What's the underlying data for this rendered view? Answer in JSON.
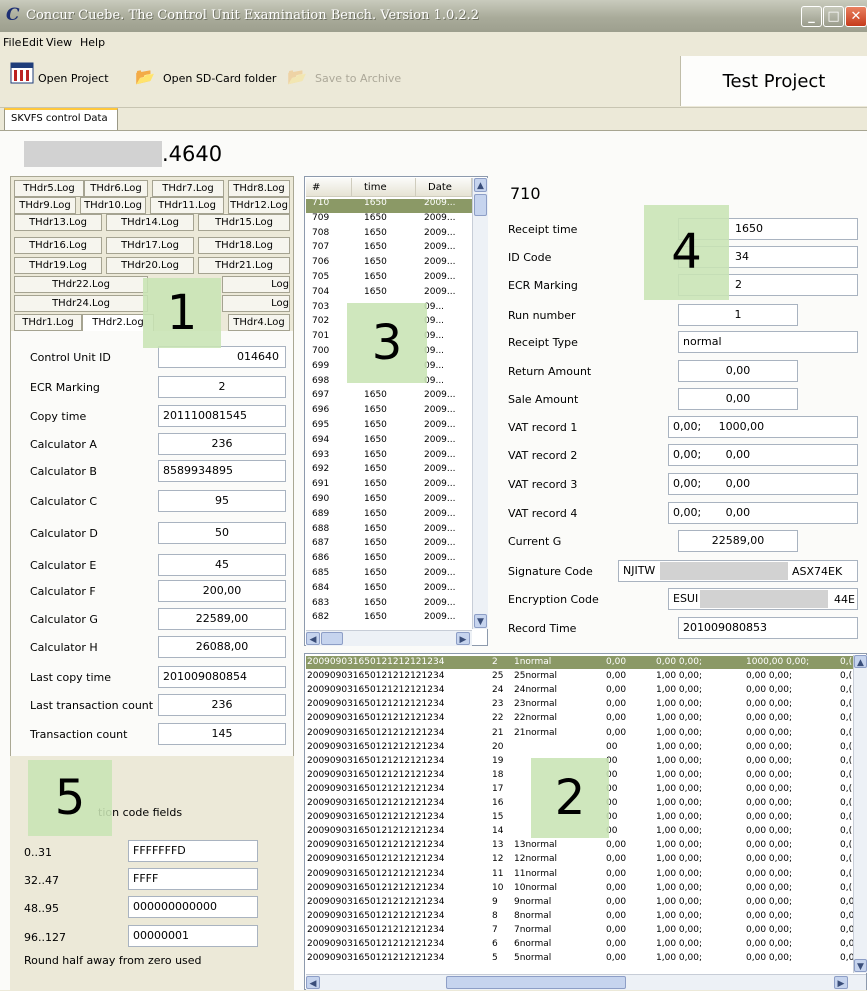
{
  "window": {
    "title": "Concur Cuebe. The Control Unit Examination Bench. Version 1.0.2.2",
    "logo_letter": "C"
  },
  "menu": [
    "File",
    "Edit",
    "View",
    "Help"
  ],
  "toolbar": {
    "open_project": "Open Project",
    "open_sd": "Open SD-Card folder",
    "save_archive": "Save to Archive",
    "project_name": "Test Project"
  },
  "main_tab": "SKVFS control Data",
  "serial_suffix": ".4640",
  "log_tabs": {
    "row1": [
      "THdr5.Log",
      "THdr6.Log",
      "THdr7.Log",
      "THdr8.Log"
    ],
    "row2": [
      "THdr9.Log",
      "THdr10.Log",
      "THdr11.Log",
      "THdr12.Log"
    ],
    "row3": [
      "THdr13.Log",
      "THdr14.Log",
      "THdr15.Log"
    ],
    "row4": [
      "THdr16.Log",
      "THdr17.Log",
      "THdr18.Log"
    ],
    "row5": [
      "THdr19.Log",
      "THdr20.Log",
      "THdr21.Log"
    ],
    "row6": [
      "THdr22.Log",
      "Log"
    ],
    "row7": [
      "THdr24.Log",
      "Log"
    ],
    "row8": [
      "THdr1.Log",
      "THdr2.Log",
      "THdr4.Log"
    ]
  },
  "control_fields": [
    {
      "label": "Control Unit ID",
      "value": "014640"
    },
    {
      "label": "ECR Marking",
      "value": "2"
    },
    {
      "label": "Copy time",
      "value": "201110081545"
    },
    {
      "label": "Calculator A",
      "value": "236"
    },
    {
      "label": "Calculator B",
      "value": "8589934895"
    },
    {
      "label": "Calculator C",
      "value": "95"
    },
    {
      "label": "Calculator D",
      "value": "50"
    },
    {
      "label": "Calculator E",
      "value": "45"
    },
    {
      "label": "Calculator F",
      "value": "200,00"
    },
    {
      "label": "Calculator G",
      "value": "22589,00"
    },
    {
      "label": "Calculator H",
      "value": "26088,00"
    },
    {
      "label": "Last copy time",
      "value": "201009080854"
    },
    {
      "label": "Last transaction count",
      "value": "236"
    },
    {
      "label": "Transaction count",
      "value": "145"
    }
  ],
  "encryption": {
    "caption": "tion code fields",
    "fields": [
      {
        "label": "0..31",
        "value": "FFFFFFFD"
      },
      {
        "label": "32..47",
        "value": "FFFF"
      },
      {
        "label": "48..95",
        "value": "000000000000"
      },
      {
        "label": "96..127",
        "value": "00000001"
      }
    ],
    "footer": "Round half away from zero used"
  },
  "receipt_list": {
    "headers": [
      "#",
      "time",
      "Date"
    ],
    "rows": [
      {
        "n": "710",
        "t": "1650",
        "d": "2009..."
      },
      {
        "n": "709",
        "t": "1650",
        "d": "2009..."
      },
      {
        "n": "708",
        "t": "1650",
        "d": "2009..."
      },
      {
        "n": "707",
        "t": "1650",
        "d": "2009..."
      },
      {
        "n": "706",
        "t": "1650",
        "d": "2009..."
      },
      {
        "n": "705",
        "t": "1650",
        "d": "2009..."
      },
      {
        "n": "704",
        "t": "1650",
        "d": "2009..."
      },
      {
        "n": "703",
        "t": "",
        "d": "09..."
      },
      {
        "n": "702",
        "t": "",
        "d": "09..."
      },
      {
        "n": "701",
        "t": "",
        "d": "09..."
      },
      {
        "n": "700",
        "t": "",
        "d": "09..."
      },
      {
        "n": "699",
        "t": "",
        "d": "09..."
      },
      {
        "n": "698",
        "t": "",
        "d": "09..."
      },
      {
        "n": "697",
        "t": "1650",
        "d": "2009..."
      },
      {
        "n": "696",
        "t": "1650",
        "d": "2009..."
      },
      {
        "n": "695",
        "t": "1650",
        "d": "2009..."
      },
      {
        "n": "694",
        "t": "1650",
        "d": "2009..."
      },
      {
        "n": "693",
        "t": "1650",
        "d": "2009..."
      },
      {
        "n": "692",
        "t": "1650",
        "d": "2009..."
      },
      {
        "n": "691",
        "t": "1650",
        "d": "2009..."
      },
      {
        "n": "690",
        "t": "1650",
        "d": "2009..."
      },
      {
        "n": "689",
        "t": "1650",
        "d": "2009..."
      },
      {
        "n": "688",
        "t": "1650",
        "d": "2009..."
      },
      {
        "n": "687",
        "t": "1650",
        "d": "2009..."
      },
      {
        "n": "686",
        "t": "1650",
        "d": "2009..."
      },
      {
        "n": "685",
        "t": "1650",
        "d": "2009..."
      },
      {
        "n": "684",
        "t": "1650",
        "d": "2009..."
      },
      {
        "n": "683",
        "t": "1650",
        "d": "2009..."
      },
      {
        "n": "682",
        "t": "1650",
        "d": "2009..."
      }
    ]
  },
  "receipt_detail": {
    "number": "710",
    "fields": [
      {
        "label": "Receipt time",
        "value": "1650"
      },
      {
        "label": "ID Code",
        "value": "34"
      },
      {
        "label": "ECR Marking",
        "value": "2"
      },
      {
        "label": "Run number",
        "value": "1"
      },
      {
        "label": "Receipt Type",
        "value": "normal"
      },
      {
        "label": "Return Amount",
        "value": "0,00"
      },
      {
        "label": "Sale Amount",
        "value": "0,00"
      },
      {
        "label": "VAT record 1",
        "value": "0,00;     1000,00"
      },
      {
        "label": "VAT record 2",
        "value": "0,00;       0,00"
      },
      {
        "label": "VAT record 3",
        "value": "0,00;       0,00"
      },
      {
        "label": "VAT record 4",
        "value": "0,00;       0,00"
      },
      {
        "label": "Current G",
        "value": "22589,00"
      },
      {
        "label": "Signature Code",
        "value": "NJITW"
      },
      {
        "label": "Encryption Code",
        "value": "ESUI"
      },
      {
        "label": "Record Time",
        "value": "201009080853"
      }
    ],
    "signature_tail": "ASX74EK",
    "encryption_tail": "44E"
  },
  "records": {
    "rows": [
      {
        "a": "200909031650121212121234",
        "b": "2",
        "c": "1normal",
        "d": "0,00",
        "e": "0,00 0,00;",
        "f": "1000,00 0,00;",
        "g": "0,("
      },
      {
        "a": "200909031650121212121234",
        "b": "25",
        "c": "25normal",
        "d": "0,00",
        "e": "1,00 0,00;",
        "f": "0,00 0,00;",
        "g": "0,("
      },
      {
        "a": "200909031650121212121234",
        "b": "24",
        "c": "24normal",
        "d": "0,00",
        "e": "1,00 0,00;",
        "f": "0,00 0,00;",
        "g": "0,("
      },
      {
        "a": "200909031650121212121234",
        "b": "23",
        "c": "23normal",
        "d": "0,00",
        "e": "1,00 0,00;",
        "f": "0,00 0,00;",
        "g": "0,("
      },
      {
        "a": "200909031650121212121234",
        "b": "22",
        "c": "22normal",
        "d": "0,00",
        "e": "1,00 0,00;",
        "f": "0,00 0,00;",
        "g": "0,("
      },
      {
        "a": "200909031650121212121234",
        "b": "21",
        "c": "21normal",
        "d": "0,00",
        "e": "1,00 0,00;",
        "f": "0,00 0,00;",
        "g": "0,("
      },
      {
        "a": "200909031650121212121234",
        "b": "20",
        "c": "",
        "d": "00",
        "e": "1,00 0,00;",
        "f": "0,00 0,00;",
        "g": "0,("
      },
      {
        "a": "200909031650121212121234",
        "b": "19",
        "c": "",
        "d": "00",
        "e": "1,00 0,00;",
        "f": "0,00 0,00;",
        "g": "0,("
      },
      {
        "a": "200909031650121212121234",
        "b": "18",
        "c": "",
        "d": "00",
        "e": "1,00 0,00;",
        "f": "0,00 0,00;",
        "g": "0,("
      },
      {
        "a": "200909031650121212121234",
        "b": "17",
        "c": "",
        "d": "00",
        "e": "1,00 0,00;",
        "f": "0,00 0,00;",
        "g": "0,("
      },
      {
        "a": "200909031650121212121234",
        "b": "16",
        "c": "",
        "d": "00",
        "e": "1,00 0,00;",
        "f": "0,00 0,00;",
        "g": "0,("
      },
      {
        "a": "200909031650121212121234",
        "b": "15",
        "c": "",
        "d": "00",
        "e": "1,00 0,00;",
        "f": "0,00 0,00;",
        "g": "0,("
      },
      {
        "a": "200909031650121212121234",
        "b": "14",
        "c": "",
        "d": "00",
        "e": "1,00 0,00;",
        "f": "0,00 0,00;",
        "g": "0,("
      },
      {
        "a": "200909031650121212121234",
        "b": "13",
        "c": "13normal",
        "d": "0,00",
        "e": "1,00 0,00;",
        "f": "0,00 0,00;",
        "g": "0,("
      },
      {
        "a": "200909031650121212121234",
        "b": "12",
        "c": "12normal",
        "d": "0,00",
        "e": "1,00 0,00;",
        "f": "0,00 0,00;",
        "g": "0,("
      },
      {
        "a": "200909031650121212121234",
        "b": "11",
        "c": "11normal",
        "d": "0,00",
        "e": "1,00 0,00;",
        "f": "0,00 0,00;",
        "g": "0,("
      },
      {
        "a": "200909031650121212121234",
        "b": "10",
        "c": "10normal",
        "d": "0,00",
        "e": "1,00 0,00;",
        "f": "0,00 0,00;",
        "g": "0,("
      },
      {
        "a": "200909031650121212121234",
        "b": "9",
        "c": "9normal",
        "d": "0,00",
        "e": "1,00 0,00;",
        "f": "0,00 0,00;",
        "g": "0,0("
      },
      {
        "a": "200909031650121212121234",
        "b": "8",
        "c": "8normal",
        "d": "0,00",
        "e": "1,00 0,00;",
        "f": "0,00 0,00;",
        "g": "0,0("
      },
      {
        "a": "200909031650121212121234",
        "b": "7",
        "c": "7normal",
        "d": "0,00",
        "e": "1,00 0,00;",
        "f": "0,00 0,00;",
        "g": "0,0("
      },
      {
        "a": "200909031650121212121234",
        "b": "6",
        "c": "6normal",
        "d": "0,00",
        "e": "1,00 0,00;",
        "f": "0,00 0,00;",
        "g": "0,0("
      },
      {
        "a": "200909031650121212121234",
        "b": "5",
        "c": "5normal",
        "d": "0,00",
        "e": "1,00 0,00;",
        "f": "0,00 0,00;",
        "g": "0,0("
      }
    ]
  },
  "callouts": [
    "1",
    "2",
    "3",
    "4",
    "5"
  ]
}
